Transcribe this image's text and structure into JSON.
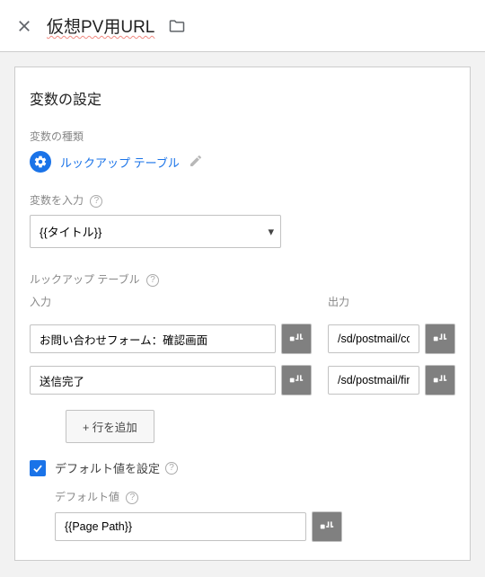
{
  "header": {
    "title": "仮想PV用URL"
  },
  "card": {
    "heading": "変数の設定",
    "type_label": "変数の種類",
    "type_name": "ルックアップ テーブル",
    "input_label": "変数を入力",
    "input_select_value": "{{タイトル}}",
    "lookup_label": "ルックアップ テーブル",
    "col_input": "入力",
    "col_output": "出力",
    "rows": [
      {
        "in": "お問い合わせフォーム：確認画面",
        "out": "/sd/postmail/confirm.html"
      },
      {
        "in": "送信完了",
        "out": "/sd/postmail/finish.html"
      }
    ],
    "add_row": "+ 行を追加",
    "default_checkbox_label": "デフォルト値を設定",
    "default_value_label": "デフォルト値",
    "default_value": "{{Page Path}}",
    "help_glyph": "?"
  }
}
